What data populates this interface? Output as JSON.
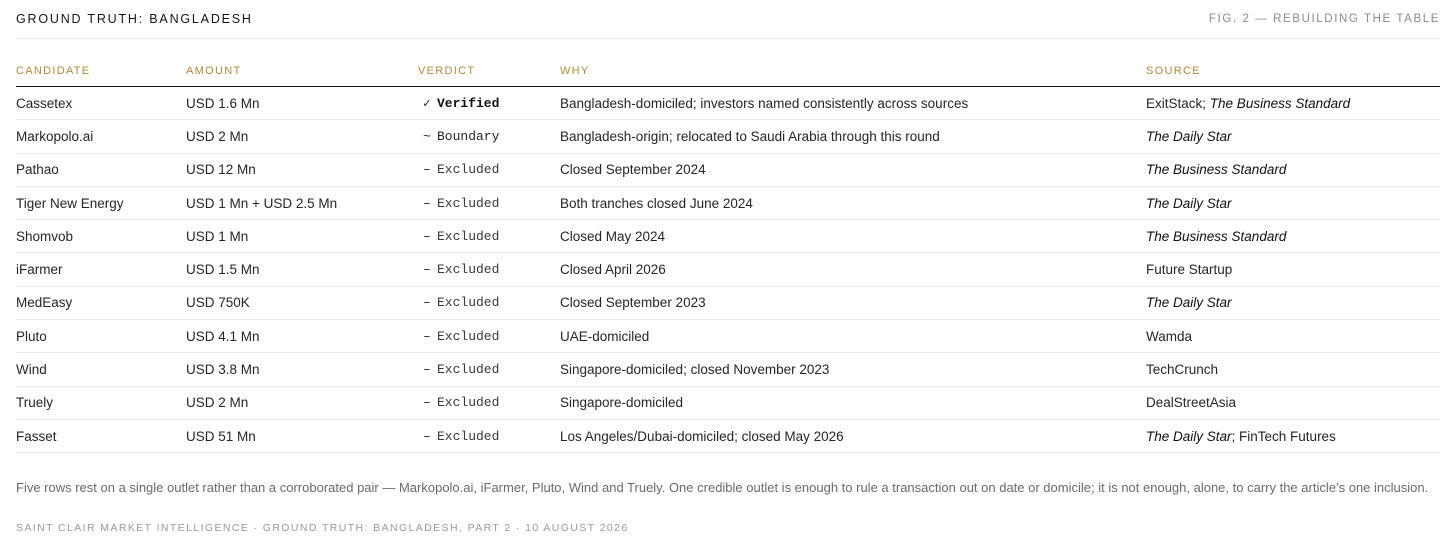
{
  "header": {
    "title": "GROUND TRUTH: BANGLADESH",
    "figure_label": "FIG. 2 — REBUILDING THE TABLE"
  },
  "table": {
    "columns": [
      "CANDIDATE",
      "AMOUNT",
      "VERDICT",
      "WHY",
      "SOURCE"
    ],
    "rows": [
      {
        "candidate": "Cassetex",
        "amount": "USD 1.6 Mn",
        "verdict_mark": "✓",
        "verdict": "Verified",
        "verdict_style": "bold",
        "why": "Bangladesh-domiciled; investors named consistently across sources",
        "source": [
          {
            "text": "ExitStack",
            "italic": false
          },
          {
            "text": "; ",
            "italic": false
          },
          {
            "text": "The Business Standard",
            "italic": true
          }
        ]
      },
      {
        "candidate": "Markopolo.ai",
        "amount": "USD 2 Mn",
        "verdict_mark": "~",
        "verdict": "Boundary",
        "verdict_style": "medium",
        "why": "Bangladesh-origin; relocated to Saudi Arabia through this round",
        "source": [
          {
            "text": "The Daily Star",
            "italic": true
          }
        ]
      },
      {
        "candidate": "Pathao",
        "amount": "USD 12 Mn",
        "verdict_mark": "–",
        "verdict": "Excluded",
        "verdict_style": "muted",
        "why": "Closed September 2024",
        "source": [
          {
            "text": "The Business Standard",
            "italic": true
          }
        ]
      },
      {
        "candidate": "Tiger New Energy",
        "amount": "USD 1 Mn + USD 2.5 Mn",
        "verdict_mark": "–",
        "verdict": "Excluded",
        "verdict_style": "muted",
        "why": "Both tranches closed June 2024",
        "source": [
          {
            "text": "The Daily Star",
            "italic": true
          }
        ]
      },
      {
        "candidate": "Shomvob",
        "amount": "USD 1 Mn",
        "verdict_mark": "–",
        "verdict": "Excluded",
        "verdict_style": "muted",
        "why": "Closed May 2024",
        "source": [
          {
            "text": "The Business Standard",
            "italic": true
          }
        ]
      },
      {
        "candidate": "iFarmer",
        "amount": "USD 1.5 Mn",
        "verdict_mark": "–",
        "verdict": "Excluded",
        "verdict_style": "muted",
        "why": "Closed April 2026",
        "source": [
          {
            "text": "Future Startup",
            "italic": false
          }
        ]
      },
      {
        "candidate": "MedEasy",
        "amount": "USD 750K",
        "verdict_mark": "–",
        "verdict": "Excluded",
        "verdict_style": "muted",
        "why": "Closed September 2023",
        "source": [
          {
            "text": "The Daily Star",
            "italic": true
          }
        ]
      },
      {
        "candidate": "Pluto",
        "amount": "USD 4.1 Mn",
        "verdict_mark": "–",
        "verdict": "Excluded",
        "verdict_style": "muted",
        "why": "UAE-domiciled",
        "source": [
          {
            "text": "Wamda",
            "italic": false
          }
        ]
      },
      {
        "candidate": "Wind",
        "amount": "USD 3.8 Mn",
        "verdict_mark": "–",
        "verdict": "Excluded",
        "verdict_style": "muted",
        "why": "Singapore-domiciled; closed November 2023",
        "source": [
          {
            "text": "TechCrunch",
            "italic": false
          }
        ]
      },
      {
        "candidate": "Truely",
        "amount": "USD 2 Mn",
        "verdict_mark": "–",
        "verdict": "Excluded",
        "verdict_style": "muted",
        "why": "Singapore-domiciled",
        "source": [
          {
            "text": "DealStreetAsia",
            "italic": false
          }
        ]
      },
      {
        "candidate": "Fasset",
        "amount": "USD 51 Mn",
        "verdict_mark": "–",
        "verdict": "Excluded",
        "verdict_style": "muted",
        "why": "Los Angeles/Dubai-domiciled; closed May 2026",
        "source": [
          {
            "text": "The Daily Star",
            "italic": true
          },
          {
            "text": "; FinTech Futures",
            "italic": false
          }
        ]
      }
    ]
  },
  "footnote": "Five rows rest on a single outlet rather than a corroborated pair — Markopolo.ai, iFarmer, Pluto, Wind and Truely. One credible outlet is enough to rule a transaction out on date or domicile; it is not enough, alone, to carry the article’s one inclusion.",
  "colophon": "SAINT CLAIR MARKET INTELLIGENCE · GROUND TRUTH: BANGLADESH, PART 2 · 10 AUGUST 2026",
  "colors": {
    "accent": "#b3893a",
    "text": "#262626",
    "muted": "#6b6b6b",
    "rule": "#e8e8e8"
  }
}
